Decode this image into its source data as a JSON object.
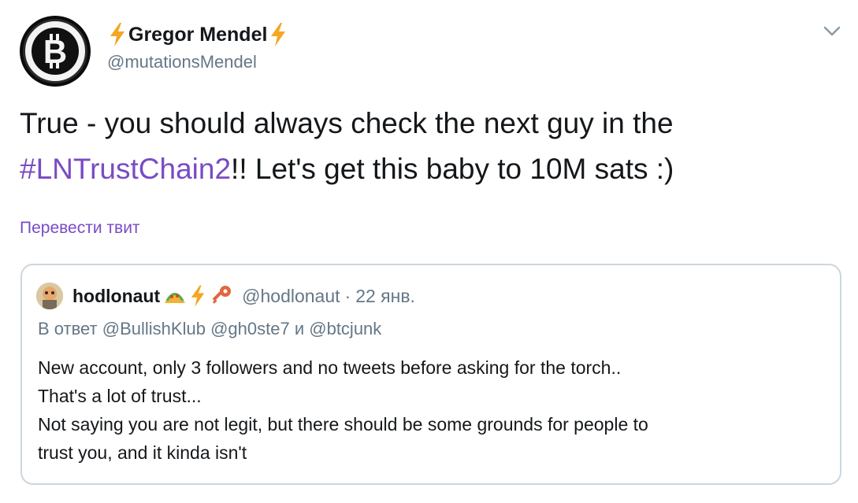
{
  "author": {
    "name": "Gregor Mendel",
    "handle": "@mutationsMendel",
    "avatar_icon": "bitcoin-logo",
    "name_emoji": "lightning-bolt"
  },
  "tweet": {
    "text_before": "True - you should always check the next guy in the ",
    "hashtag": "#LNTrustChain2",
    "text_after": "!! Let's get this baby to 10M sats :)",
    "translate_label": "Перевести твит"
  },
  "quoted": {
    "name": "hodlonaut",
    "name_emojis": [
      "taco",
      "lightning-bolt",
      "key"
    ],
    "handle": "@hodlonaut",
    "separator": "·",
    "date": "22 янв.",
    "reply_prefix": "В ответ",
    "reply_mentions": [
      "@BullishKlub",
      "@gh0ste7"
    ],
    "reply_conjunction": "и",
    "reply_last": "@btcjunk",
    "lines": [
      "New account, only 3 followers and no tweets before asking for the torch..",
      "That's a lot of trust...",
      "Not saying you are not legit, but there should be some grounds for people to",
      "trust you, and it kinda isn't"
    ]
  },
  "colors": {
    "accent": "#794bc4",
    "secondary_text": "#657786",
    "border": "#ccd6dd",
    "bolt": "#f5a623"
  }
}
